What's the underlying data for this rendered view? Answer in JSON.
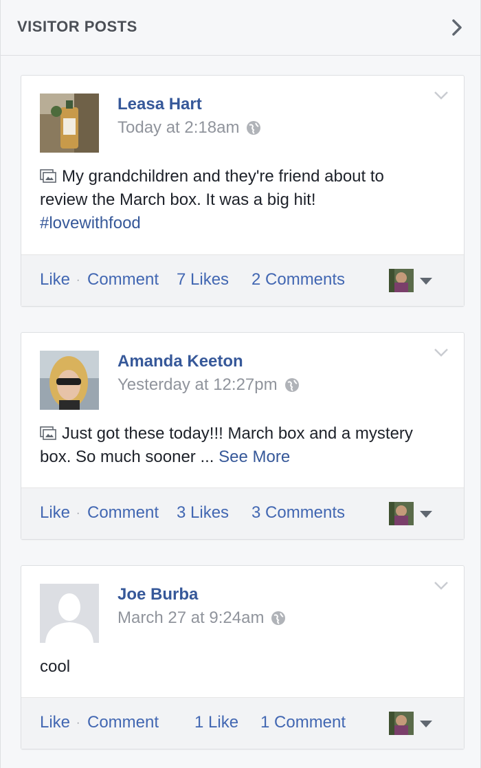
{
  "header": {
    "title": "VISITOR POSTS",
    "chevron_icon": "chevron-right-icon"
  },
  "posts": [
    {
      "author": "Leasa Hart",
      "timestamp": "Today at 2:18am",
      "text_lines": [
        "My grandchildren and they're friend about to",
        "review the March box. It was a big hit!"
      ],
      "hashtag": "#lovewithfood",
      "like": "Like",
      "sep": "·",
      "comment": "Comment",
      "likes_count": "7 Likes",
      "comments_count": "2 Comments"
    },
    {
      "author": "Amanda Keeton",
      "timestamp": "Yesterday at 12:27pm",
      "text_line1": "Just got these today!!! March box and a mystery",
      "text_line2": "box. So much sooner ...",
      "see_more": "See More",
      "like": "Like",
      "sep": "·",
      "comment": "Comment",
      "likes_count": "3 Likes",
      "comments_count": "3 Comments"
    },
    {
      "author": "Joe Burba",
      "timestamp": "March 27 at 9:24am",
      "text": "cool",
      "like": "Like",
      "sep": "·",
      "comment": "Comment",
      "likes_count": "1 Like",
      "comments_count": "1 Comment"
    }
  ],
  "colors": {
    "link": "#365899",
    "action": "#4267b2",
    "meta": "#90949c"
  }
}
